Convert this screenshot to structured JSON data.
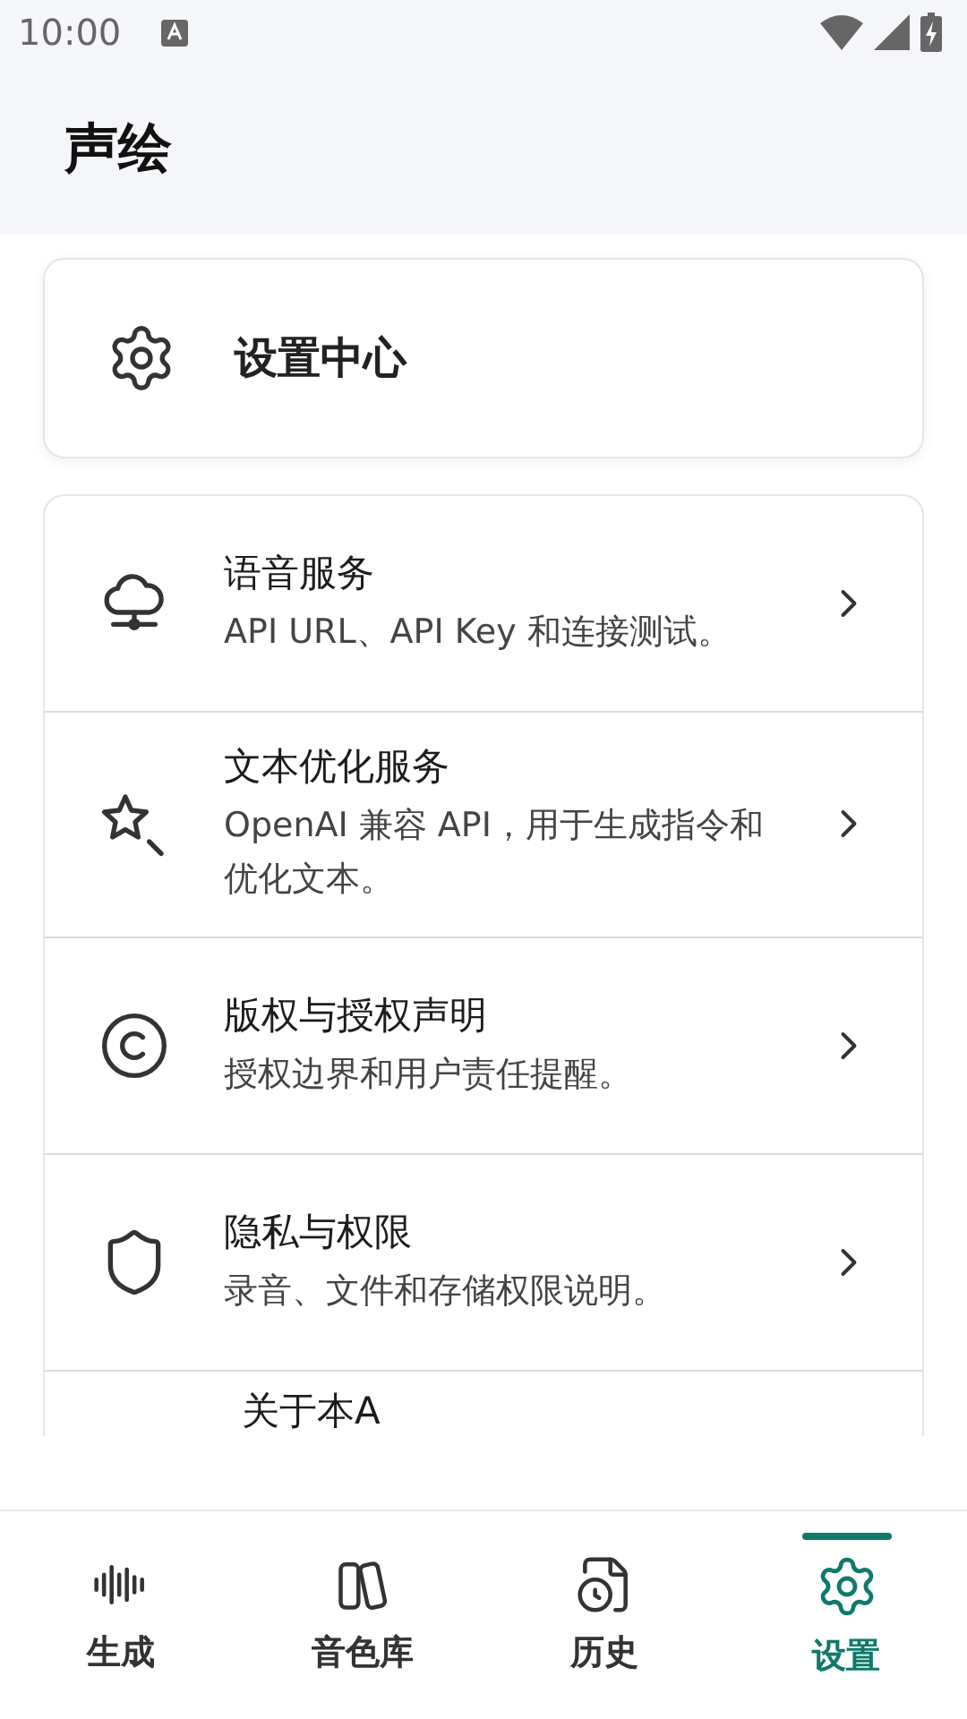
{
  "status_bar": {
    "time": "10:00"
  },
  "app_bar": {
    "title": "声绘"
  },
  "header_card": {
    "title": "设置中心"
  },
  "settings_items": [
    {
      "kind": "cloud",
      "title": "语音服务",
      "subtitle": "API URL、API Key 和连接测试。"
    },
    {
      "kind": "wand",
      "title": "文本优化服务",
      "subtitle": "OpenAI 兼容 API，用于生成指令和优化文本。"
    },
    {
      "kind": "copyright",
      "title": "版权与授权声明",
      "subtitle": "授权边界和用户责任提醒。"
    },
    {
      "kind": "shield",
      "title": "隐私与权限",
      "subtitle": "录音、文件和存储权限说明。"
    },
    {
      "kind": "cut",
      "title": "关于本A"
    }
  ],
  "nav": [
    {
      "kind": "wave",
      "label": "生成",
      "selected": false
    },
    {
      "kind": "books",
      "label": "音色库",
      "selected": false
    },
    {
      "kind": "history",
      "label": "历史",
      "selected": false
    },
    {
      "kind": "gear",
      "label": "设置",
      "selected": true
    }
  ]
}
